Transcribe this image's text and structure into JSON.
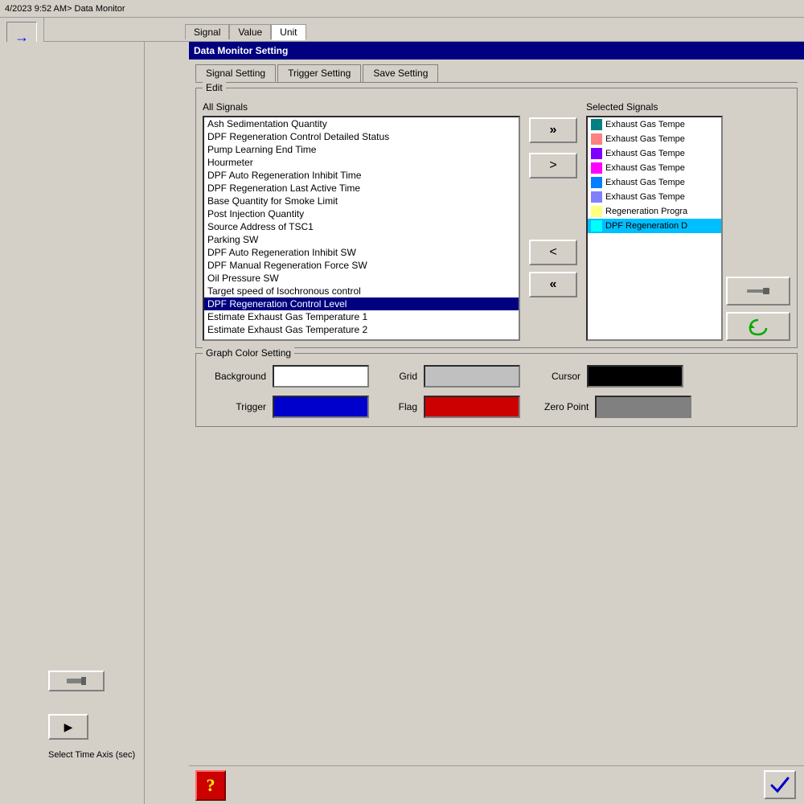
{
  "titlebar": {
    "text": "4/2023 9:52 AM> Data Monitor"
  },
  "column_headers": {
    "signal": "Signal",
    "value": "Value",
    "unit": "Unit"
  },
  "dm_window": {
    "title": "Data Monitor Setting"
  },
  "tabs": {
    "signal_setting": "Signal Setting",
    "trigger_setting": "Trigger Setting",
    "save_setting": "Save Setting"
  },
  "edit_group": {
    "label": "Edit"
  },
  "all_signals_label": "All Signals",
  "selected_signals_label": "Selected Signals",
  "all_signals_list": [
    "Ash Sedimentation Quantity",
    "DPF Regeneration Control Detailed Status",
    "Pump Learning End Time",
    "Hourmeter",
    "DPF Auto Regeneration Inhibit Time",
    "DPF Regeneration Last Active Time",
    "Base Quantity for Smoke Limit",
    "Post Injection Quantity",
    "Source Address of TSC1",
    "Parking SW",
    "DPF Auto Regeneration Inhibit SW",
    "DPF Manual Regeneration Force SW",
    "Oil Pressure SW",
    "Target speed of  Isochronous control",
    "DPF Regeneration Control Level",
    "Estimate Exhaust Gas Temperature 1",
    "Estimate Exhaust Gas Temperature 2"
  ],
  "selected_item_index": 14,
  "selected_signals": [
    {
      "label": "Exhaust Gas Tempe",
      "color": "#008080",
      "highlighted": false
    },
    {
      "label": "Exhaust Gas Tempe",
      "color": "#ff8080",
      "highlighted": false
    },
    {
      "label": "Exhaust Gas Tempe",
      "color": "#8000ff",
      "highlighted": false
    },
    {
      "label": "Exhaust Gas Tempe",
      "color": "#ff00ff",
      "highlighted": false
    },
    {
      "label": "Exhaust Gas Tempe",
      "color": "#0080ff",
      "highlighted": false
    },
    {
      "label": "Exhaust Gas Tempe",
      "color": "#8080ff",
      "highlighted": false
    },
    {
      "label": "Regeneration Progra",
      "color": "#ffff80",
      "highlighted": false
    },
    {
      "label": "DPF Regeneration D",
      "color": "#00ffff",
      "highlighted": true
    }
  ],
  "buttons": {
    "move_all_right": "»",
    "move_right": ">",
    "move_left": "<",
    "move_all_left": "«"
  },
  "graph_color": {
    "label": "Graph Color Setting",
    "background_label": "Background",
    "background_color": "#ffffff",
    "grid_label": "Grid",
    "grid_color": "#c0c0c0",
    "cursor_label": "Cursor",
    "cursor_color": "#000000",
    "trigger_label": "Trigger",
    "trigger_color": "#0000cc",
    "flag_label": "Flag",
    "flag_color": "#cc0000",
    "zero_point_label": "Zero Point",
    "zero_point_color": "#808080"
  },
  "bottom": {
    "help_icon": "?",
    "ok_icon": "✓"
  },
  "left_panel": {
    "select_time_axis": "Select Time Axis (sec)",
    "play_icon": "▶"
  }
}
